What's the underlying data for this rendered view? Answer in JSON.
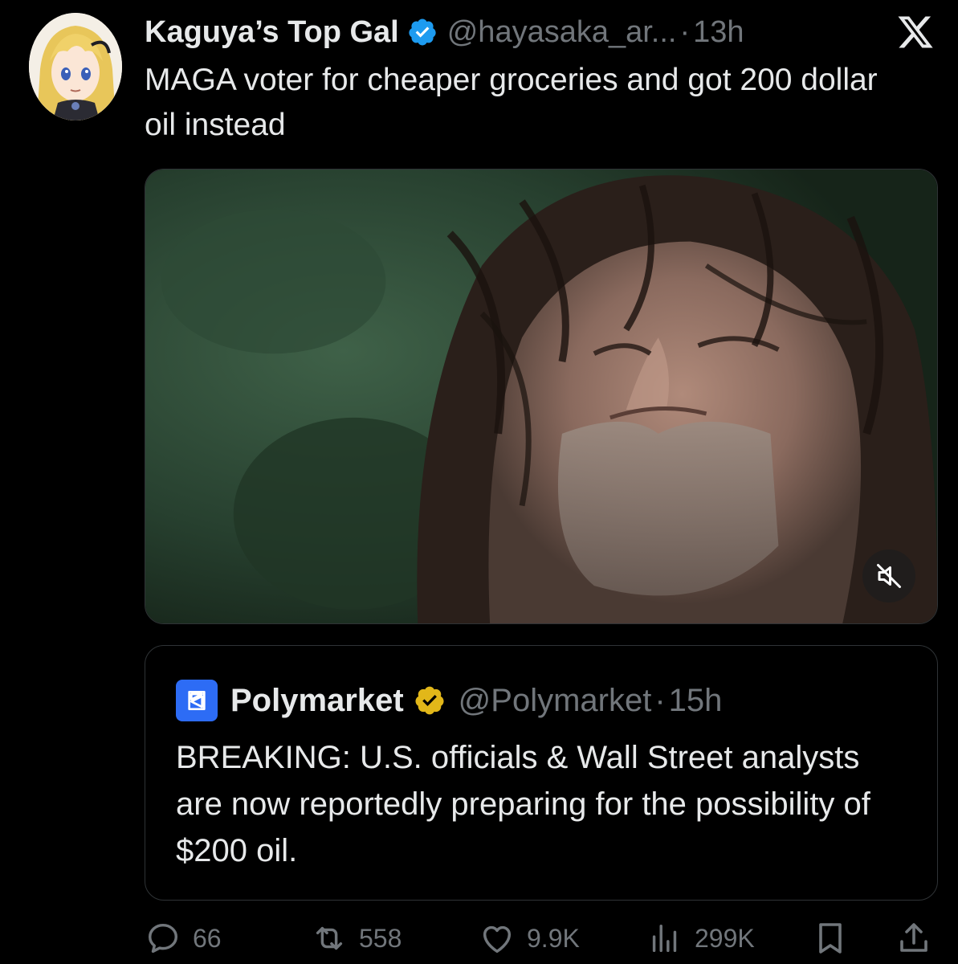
{
  "tweet": {
    "display_name": "Kaguya’s Top Gal",
    "handle": "@hayasaka_ar...",
    "separator": "·",
    "time": "13h",
    "text": "MAGA voter for cheaper groceries and got 200 dollar oil instead"
  },
  "quoted_tweet": {
    "display_name": "Polymarket",
    "handle": "@Polymarket",
    "separator": "·",
    "time": "15h",
    "text": "BREAKING: U.S. officials & Wall Street analysts are now reportedly preparing for the possibility of $200 oil."
  },
  "metrics": {
    "replies": "66",
    "reposts": "558",
    "likes": "9.9K",
    "views": "299K"
  },
  "icons": {
    "verified": "verified-badge-icon",
    "quote_verified": "gold-verified-badge-icon",
    "brand": "x-logo-icon",
    "mute": "speaker-muted-icon",
    "reply": "reply-icon",
    "repost": "repost-icon",
    "like": "heart-icon",
    "views": "views-icon",
    "bookmark": "bookmark-icon",
    "share": "share-icon"
  },
  "colors": {
    "background": "#000000",
    "text_primary": "#e7e9ea",
    "text_secondary": "#71767b",
    "border": "#2f3336",
    "verified_blue": "#1d9bf0",
    "verified_gold": "#e2b719",
    "polymarket_blue": "#2d6cf5"
  }
}
